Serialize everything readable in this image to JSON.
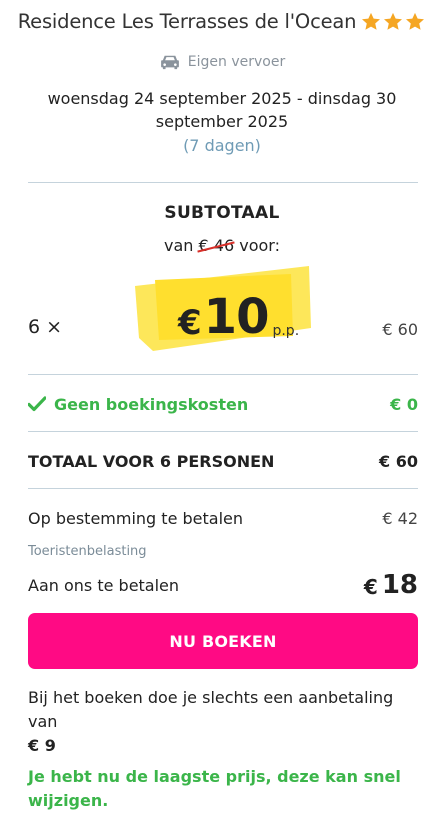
{
  "header": {
    "title": "Residence Les Terrasses de l'Ocean",
    "stars": 3,
    "star_color": "#f5a623"
  },
  "transport": {
    "icon": "car-icon",
    "label": "Eigen vervoer"
  },
  "dates": {
    "range": "woensdag 24 september 2025 - dinsdag 30 september 2025",
    "duration": "(7 dagen)"
  },
  "subtotal": {
    "heading": "SUBTOTAAL",
    "from_prefix": "van",
    "old_price": "€ 46",
    "from_suffix": "voor:",
    "quantity": "6 ×",
    "currency": "€",
    "price": "10",
    "per_person": "p.p.",
    "line_total": "€ 60"
  },
  "fees": {
    "label": "Geen boekingskosten",
    "amount": "€ 0",
    "color": "#3bb54a"
  },
  "total": {
    "label": "TOTAAL VOOR 6 PERSONEN",
    "amount": "€ 60"
  },
  "destination": {
    "label": "Op bestemming te betalen",
    "amount": "€ 42",
    "note": "Toeristenbelasting"
  },
  "pay_us": {
    "label": "Aan ons te betalen",
    "currency": "€",
    "amount": "18"
  },
  "cta": {
    "label": "NU BOEKEN",
    "color": "#ff0a84"
  },
  "deposit": {
    "text": "Bij het boeken doe je slechts een aanbetaling van",
    "amount": "€ 9"
  },
  "notice": "Je hebt nu de laagste prijs, deze kan snel wijzigen."
}
